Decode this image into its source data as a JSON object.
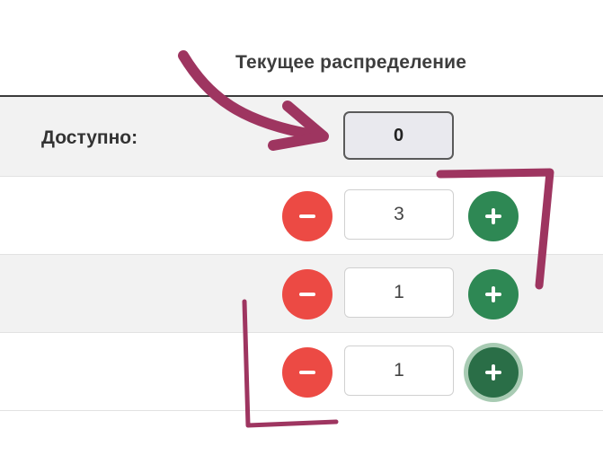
{
  "column_header": "Текущее распределение",
  "available": {
    "label": "Доступно:",
    "value": "0"
  },
  "rows": [
    {
      "value": "3"
    },
    {
      "value": "1"
    },
    {
      "value": "1"
    }
  ],
  "icons": {
    "decrement": "minus-icon",
    "increment": "plus-icon"
  },
  "colors": {
    "decrement_button": "#ec4a44",
    "increment_button": "#2e8854",
    "increment_button_focused": "#2a6e47",
    "annotation_marker": "#9e3560"
  }
}
